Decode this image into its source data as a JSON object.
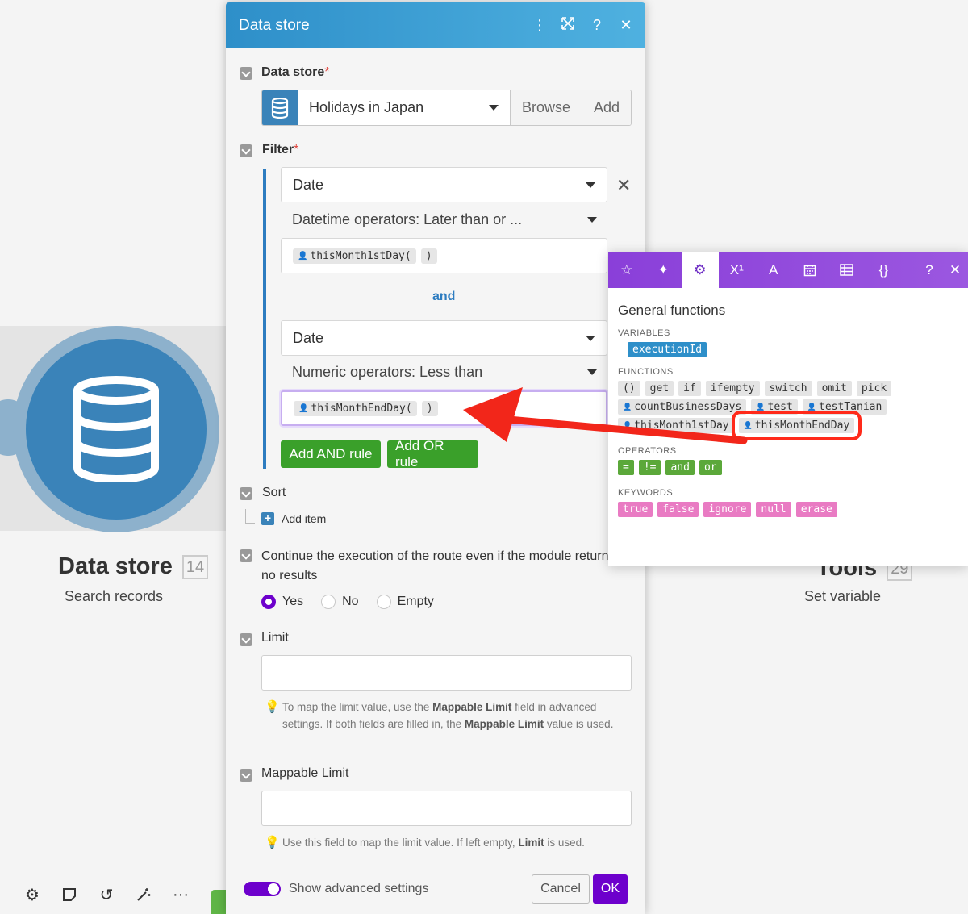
{
  "canvas": {
    "node_title": "Data store",
    "node_badge": "14",
    "node_subtitle": "Search records",
    "tools_title": "Tools",
    "tools_badge": "29",
    "tools_subtitle": "Set variable"
  },
  "dialog": {
    "title": "Data store",
    "header_icons": [
      "kebab-icon",
      "expand-icon",
      "help-icon",
      "close-icon"
    ],
    "data_store_label": "Data store",
    "required_mark": "*",
    "data_store_value": "Holidays in Japan",
    "browse_label": "Browse",
    "add_label": "Add",
    "filter_label": "Filter",
    "rule1_field": "Date",
    "rule1_operator": "Datetime operators: Later than or ...",
    "rule1_value_fn": "thisMonth1stDay(",
    "rule1_value_close": ")",
    "and_label": "and",
    "rule2_field": "Date",
    "rule2_operator": "Numeric operators: Less than",
    "rule2_value_fn": "thisMonthEndDay(",
    "rule2_value_close": ")",
    "add_and_rule": "Add AND rule",
    "add_or_rule": "Add OR rule",
    "sort_label": "Sort",
    "add_item_label": "Add item",
    "continue_label": "Continue the execution of the route even if the module returns no results",
    "radio_yes": "Yes",
    "radio_no": "No",
    "radio_empty": "Empty",
    "limit_label": "Limit",
    "limit_hint_1": "To map the limit value, use the ",
    "limit_hint_b1": "Mappable Limit",
    "limit_hint_2": " field in advanced settings. If both fields are filled in, the ",
    "limit_hint_b2": "Mappable Limit",
    "limit_hint_3": " value is used.",
    "mappable_limit_label": "Mappable Limit",
    "mappable_hint_1": "Use this field to map the limit value. If left empty, ",
    "mappable_hint_b": "Limit",
    "mappable_hint_2": " is used.",
    "show_advanced": "Show advanced settings",
    "cancel": "Cancel",
    "ok": "OK"
  },
  "function_panel": {
    "tab_superscript": "X¹",
    "tab_text": "A",
    "tab_json": "{}",
    "tab_help": "?",
    "tab_close": "✕",
    "title": "General functions",
    "variables_heading": "VARIABLES",
    "variables": [
      "executionId"
    ],
    "functions_heading": "FUNCTIONS",
    "functions": [
      "()",
      "get",
      "if",
      "ifempty",
      "switch",
      "omit",
      "pick"
    ],
    "custom_functions": [
      "countBusinessDays",
      "test",
      "testTanian",
      "thisMonth1stDay",
      "thisMonthEndDay"
    ],
    "operators_heading": "OPERATORS",
    "operators": [
      "=",
      "!=",
      "and",
      "or"
    ],
    "keywords_heading": "KEYWORDS",
    "keywords": [
      "true",
      "false",
      "ignore",
      "null",
      "erase"
    ]
  },
  "colors": {
    "accent_purple": "#6d00cc",
    "header_blue": "#2e8fc9",
    "add_green": "#3aa02a",
    "highlight_red": "#ff2a1a"
  }
}
